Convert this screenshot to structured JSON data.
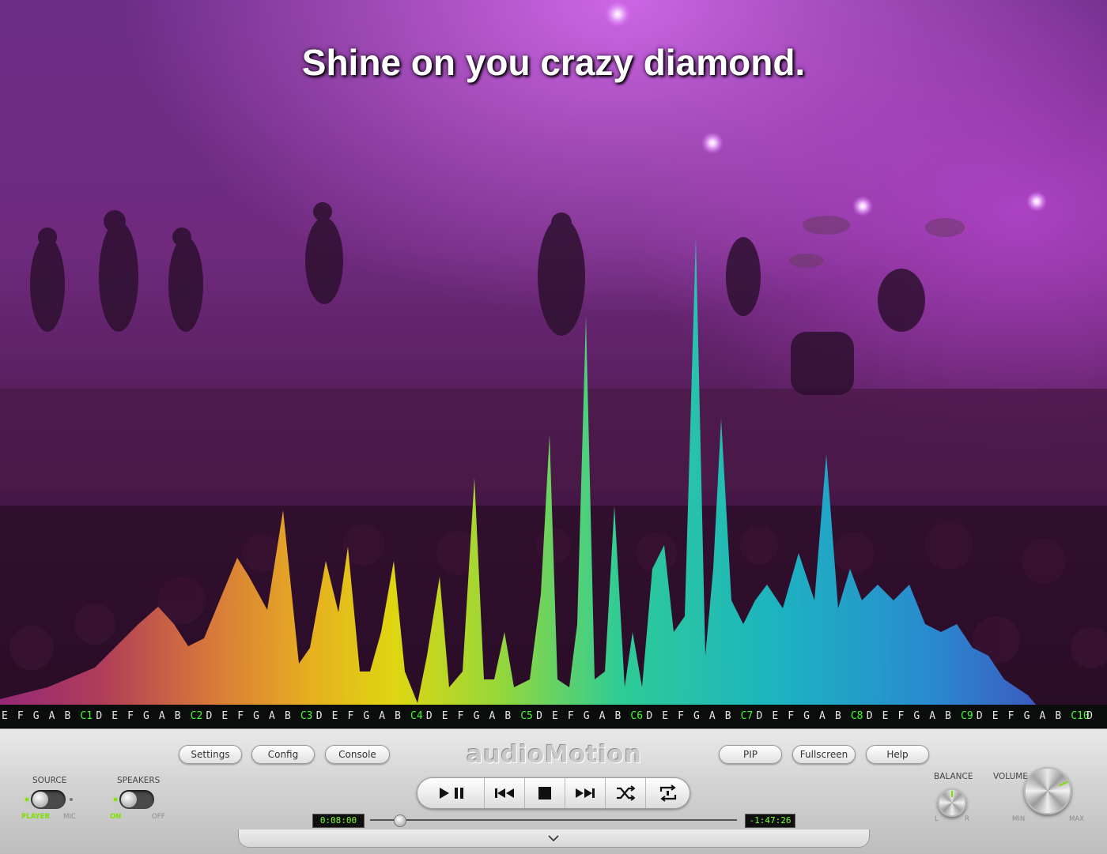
{
  "lyrics": "Shine on you crazy diamond.",
  "scale": {
    "notes": [
      "E",
      "F",
      "G",
      "A",
      "B",
      "C1",
      "D",
      "E",
      "F",
      "G",
      "A",
      "B",
      "C2",
      "D",
      "E",
      "F",
      "G",
      "A",
      "B",
      "C3",
      "D",
      "E",
      "F",
      "G",
      "A",
      "B",
      "C4",
      "D",
      "E",
      "F",
      "G",
      "A",
      "B",
      "C5",
      "D",
      "E",
      "F",
      "G",
      "A",
      "B",
      "C6",
      "D",
      "E",
      "F",
      "G",
      "A",
      "B",
      "C7",
      "D",
      "E",
      "F",
      "G",
      "A",
      "B",
      "C8",
      "D",
      "E",
      "F",
      "G",
      "A",
      "B",
      "C9",
      "D",
      "E",
      "F",
      "G",
      "A",
      "B",
      "C10",
      "D"
    ]
  },
  "panel": {
    "logo": "audioMotion",
    "buttons": {
      "settings": "Settings",
      "config": "Config",
      "console": "Console",
      "pip": "PIP",
      "fullscreen": "Fullscreen",
      "help": "Help"
    },
    "source": {
      "label": "SOURCE",
      "option_on": "PLAYER",
      "option_off": "MIC"
    },
    "speakers": {
      "label": "SPEAKERS",
      "option_on": "ON",
      "option_off": "OFF"
    },
    "elapsed": "0:08:00",
    "remaining": "-1:47:26",
    "progress_fraction": 0.08,
    "balance": {
      "label": "BALANCE",
      "left": "L",
      "right": "R"
    },
    "volume": {
      "label": "VOLUME",
      "min": "MIN",
      "max": "MAX"
    },
    "transport_icons": [
      "play-pause-icon",
      "previous-track-icon",
      "stop-icon",
      "next-track-icon",
      "shuffle-icon",
      "repeat-icon"
    ]
  },
  "colors": {
    "accent_green": "#7be000",
    "lcd_text": "#7dff2e",
    "octave_label": "#3cff2a"
  }
}
